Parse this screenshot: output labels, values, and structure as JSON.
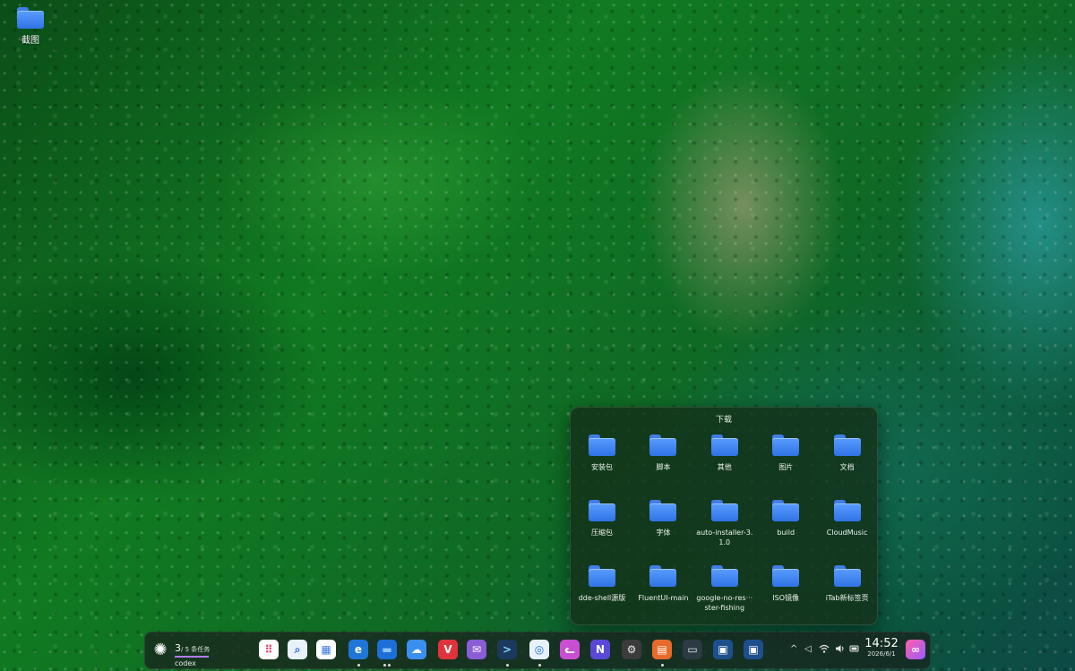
{
  "desktop": {
    "icons": [
      {
        "label": "截图",
        "icon": "folder-icon"
      }
    ]
  },
  "folder_popup": {
    "title": "下载",
    "items": [
      "安装包",
      "脚本",
      "其他",
      "图片",
      "文档",
      "压缩包",
      "字体",
      "auto-installer-3.1.0",
      "build",
      "CloudMusic",
      "dde-shell源版",
      "FluentUI-main",
      "google-no-res···ster-fishing",
      "ISO镜像",
      "iTab新标签页"
    ]
  },
  "taskbar": {
    "ai_icon": "openai-icon",
    "workspace": {
      "current": "3",
      "total": "/ 5 条任务",
      "name": "codex"
    },
    "apps": [
      {
        "name": "launcher-grid-icon",
        "color": "#ffffff",
        "glyph": "⠿",
        "fg": "#e0567a"
      },
      {
        "name": "search-icon",
        "color": "#e9f1ff",
        "glyph": "⌕",
        "fg": "#2b6fd8"
      },
      {
        "name": "app-store-icon",
        "color": "#ffffff",
        "glyph": "▦",
        "fg": "#3a7be0"
      },
      {
        "name": "edge-browser-icon",
        "color": "#1f76d8",
        "glyph": "e",
        "fg": "#ffffff",
        "running": true
      },
      {
        "name": "file-manager-icon",
        "color": "#1c6fd9",
        "glyph": "▬",
        "fg": "#8fc2ff",
        "running": true,
        "dual": true
      },
      {
        "name": "cloud-icon",
        "color": "#3b8ff0",
        "glyph": "☁",
        "fg": "#ffffff"
      },
      {
        "name": "vivaldi-icon",
        "color": "#e0343a",
        "glyph": "V",
        "fg": "#ffffff"
      },
      {
        "name": "mail-icon",
        "color": "#8a5cd6",
        "glyph": "✉",
        "fg": "#ffffff"
      },
      {
        "name": "terminal-icon",
        "color": "#1b3a5e",
        "glyph": ">",
        "fg": "#7fd4ff",
        "running": true
      },
      {
        "name": "screenshot-icon",
        "color": "#e8f2ff",
        "glyph": "◎",
        "fg": "#1e6bd6",
        "running": true
      },
      {
        "name": "cat-app-icon",
        "color": "#c84fd1",
        "glyph": "ᓚ",
        "fg": "#ffffff"
      },
      {
        "name": "notion-like-icon",
        "color": "#5a48d8",
        "glyph": "N",
        "fg": "#ffffff"
      },
      {
        "name": "settings-gear-icon",
        "color": "#3b3b3b",
        "glyph": "⚙",
        "fg": "#e8e8e8"
      },
      {
        "name": "shopping-bag-icon",
        "color": "#e86a2a",
        "glyph": "▤",
        "fg": "#ffffff",
        "running": true
      },
      {
        "name": "window-switch-icon",
        "color": "#2c3a44",
        "glyph": "▭",
        "fg": "#dfe8f0"
      },
      {
        "name": "window-a-icon",
        "color": "#1d4f8c",
        "glyph": "▣",
        "fg": "#ffffff"
      },
      {
        "name": "window-b-icon",
        "color": "#1d4f8c",
        "glyph": "▣",
        "fg": "#ffffff"
      }
    ],
    "tray": {
      "chevron": "^",
      "back": "◁",
      "wifi": "wifi-icon",
      "volume": "volume-icon",
      "battery": "battery-icon"
    },
    "clock": {
      "time": "14:52",
      "date": "2026/6/1"
    },
    "corner_app": "notification-app-icon"
  }
}
